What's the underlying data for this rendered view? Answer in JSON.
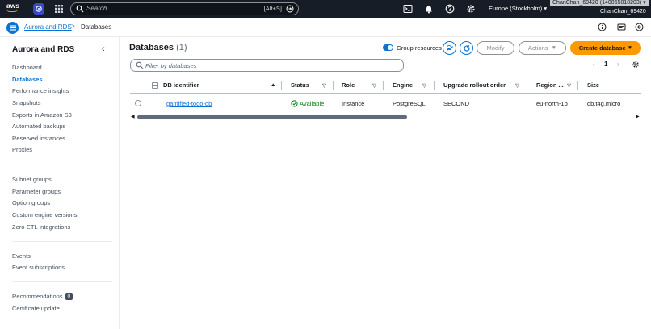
{
  "topnav": {
    "logo": "aws",
    "search_placeholder": "Search",
    "search_shortcut": "[Alt+S]",
    "region": "Europe (Stockholm) ▾",
    "account": "ChanChan_69420 (140065018203) ▾",
    "account_name": "ChanChan_69420",
    "icons": [
      "aws-logo",
      "rds-service-icon",
      "services-grid-icon",
      "search-icon",
      "cloudshell-icon",
      "notifications-bell-icon",
      "help-icon",
      "settings-gear-icon"
    ]
  },
  "breadcrumb": {
    "items": [
      "Aurora and RDS",
      "Databases"
    ],
    "separator": ">"
  },
  "sidebar": {
    "title": "Aurora and RDS",
    "close_glyph": "‹",
    "group1": [
      "Dashboard",
      "Databases",
      "Performance insights",
      "Snapshots",
      "Exports in Amazon S3",
      "Automated backups",
      "Reserved instances",
      "Proxies"
    ],
    "group2": [
      "Subnet groups",
      "Parameter groups",
      "Option groups",
      "Custom engine versions",
      "Zero-ETL integrations"
    ],
    "group3": [
      "Events",
      "Event subscriptions"
    ],
    "group4_recommendations": "Recommendations",
    "recommendations_count": "0",
    "group4_cert": "Certificate update",
    "active": "Databases"
  },
  "main": {
    "title": "Databases",
    "count": "(1)",
    "group_resources_label": "Group resources",
    "group_resources_on": true,
    "modify_label": "Modify",
    "actions_label": "Actions",
    "create_label": "Create database",
    "filter_placeholder": "Filter by databases",
    "page_number": "1",
    "pager_prev": "‹",
    "pager_next": "›",
    "columns": [
      "DB identifier",
      "Status",
      "Role",
      "Engine",
      "Upgrade rollout order",
      "Region ...",
      "Size"
    ],
    "rows": [
      {
        "db_identifier": "gamified-todo-db",
        "status": "Available",
        "role": "Instance",
        "engine": "PostgreSQL",
        "upgrade_rollout_order": "SECOND",
        "region": "eu-north-1b",
        "size": "db.t4g.micro"
      }
    ],
    "scroll_left": "◀",
    "scroll_right": "▶"
  },
  "colors": {
    "nav_bg": "#161d26",
    "link": "#0972d3",
    "primary": "#ff9900",
    "success": "#037f0c"
  }
}
